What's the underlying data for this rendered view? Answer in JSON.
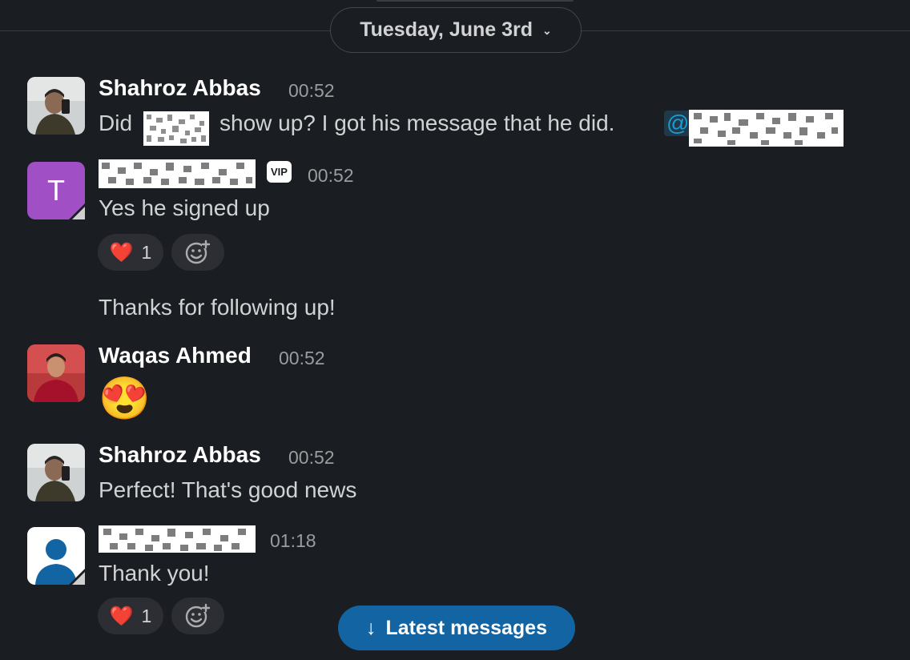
{
  "date_divider": {
    "label": "Tuesday, June 3rd",
    "chevron": "chevron-down-icon"
  },
  "messages": [
    {
      "author": "Shahroz Abbas",
      "time": "00:52",
      "text_before": "Did",
      "text_middle": "show up? I got his message that he did.",
      "mention_prefix": "@"
    },
    {
      "author_redacted": true,
      "avatar_letter": "T",
      "badge": "VIP",
      "time": "00:52",
      "text": "Yes he signed up",
      "reaction": {
        "emoji": "❤️",
        "count": "1"
      }
    },
    {
      "text": "Thanks for following up!"
    },
    {
      "author": "Waqas Ahmed",
      "time": "00:52",
      "emoji": "😍"
    },
    {
      "author": "Shahroz Abbas",
      "time": "00:52",
      "text": "Perfect! That's good news"
    },
    {
      "author_redacted": true,
      "time": "01:18",
      "text": "Thank you!",
      "reaction": {
        "emoji": "❤️",
        "count": "1"
      }
    }
  ],
  "latest_button": {
    "arrow": "↓",
    "label": "Latest messages"
  },
  "colors": {
    "background": "#1a1d21",
    "accent": "#1264a3",
    "mention": "#1d9bd1",
    "avatar_t": "#a04fc5"
  }
}
